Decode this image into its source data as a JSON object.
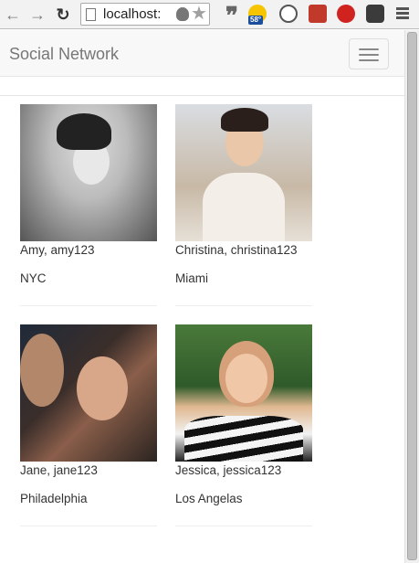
{
  "browser": {
    "url": "localhost:",
    "extensions": {
      "quote": "❞",
      "weather_temp": "58°"
    }
  },
  "navbar": {
    "brand": "Social Network"
  },
  "people": [
    {
      "name_line": "Amy, amy123",
      "city": "NYC",
      "photo_icon": "profile-photo-amy"
    },
    {
      "name_line": "Christina, christina123",
      "city": "Miami",
      "photo_icon": "profile-photo-christina"
    },
    {
      "name_line": "Jane, jane123",
      "city": "Philadelphia",
      "photo_icon": "profile-photo-jane"
    },
    {
      "name_line": "Jessica, jessica123",
      "city": "Los Angelas",
      "photo_icon": "profile-photo-jessica"
    }
  ]
}
